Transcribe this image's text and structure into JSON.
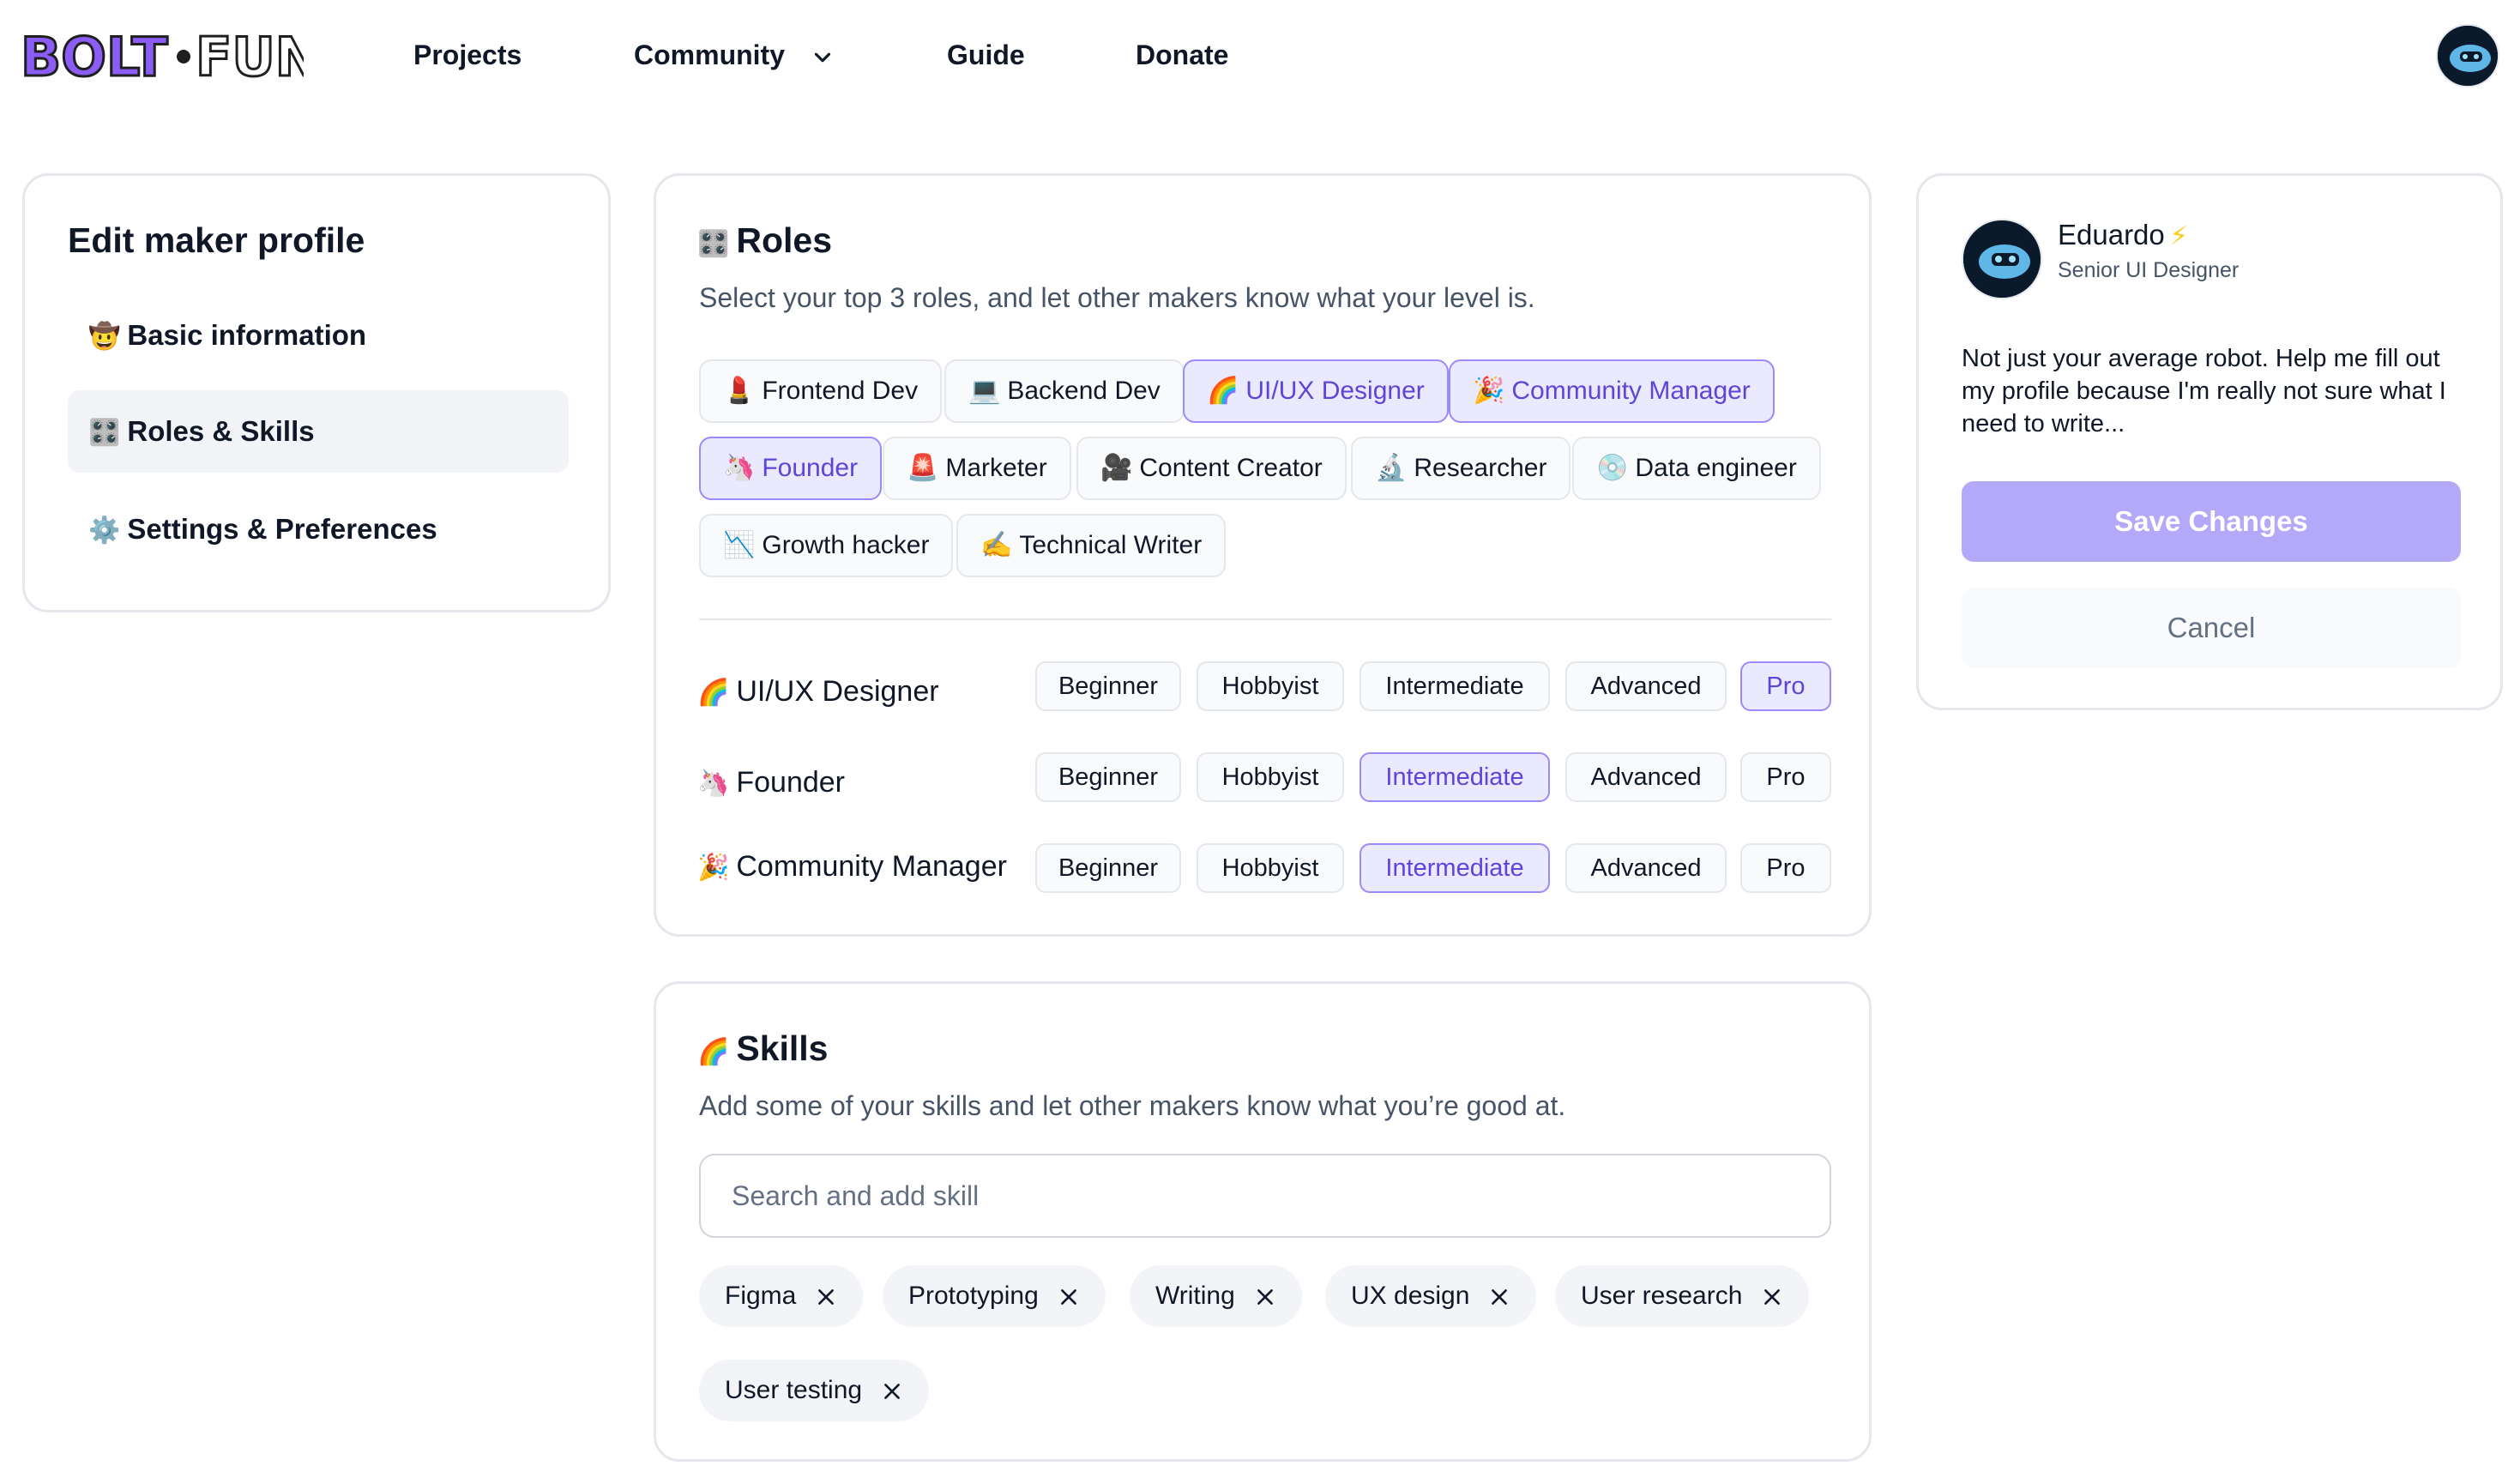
{
  "nav": {
    "logo_text": "BOLT.FUN",
    "links": [
      "Projects",
      "Community",
      "Guide",
      "Donate"
    ],
    "avatar_icon": "robot-avatar-icon"
  },
  "left": {
    "title": "Edit maker profile",
    "items": [
      {
        "emoji": "🤠",
        "label": "Basic information"
      },
      {
        "emoji": "🎛️",
        "label": "Roles & Skills"
      },
      {
        "emoji": "⚙️",
        "label": "Settings & Preferences"
      }
    ],
    "active_index": 1
  },
  "roles": {
    "title_emoji": "🎛️",
    "title": "Roles",
    "subtitle": "Select your top 3 roles, and let other makers know what your level is.",
    "chips": [
      {
        "emoji": "💄",
        "label": "Frontend Dev",
        "selected": false
      },
      {
        "emoji": "💻",
        "label": "Backend Dev",
        "selected": false
      },
      {
        "emoji": "🌈",
        "label": "UI/UX Designer",
        "selected": true
      },
      {
        "emoji": "🎉",
        "label": "Community Manager",
        "selected": true
      },
      {
        "emoji": "🦄",
        "label": "Founder",
        "selected": true
      },
      {
        "emoji": "🚨",
        "label": "Marketer",
        "selected": false
      },
      {
        "emoji": "🎥",
        "label": "Content Creator",
        "selected": false
      },
      {
        "emoji": "🔬",
        "label": "Researcher",
        "selected": false
      },
      {
        "emoji": "💿",
        "label": "Data engineer",
        "selected": false
      },
      {
        "emoji": "📉",
        "label": "Growth hacker",
        "selected": false
      },
      {
        "emoji": "✍️",
        "label": "Technical Writer",
        "selected": false
      }
    ],
    "levels": [
      "Beginner",
      "Hobbyist",
      "Intermediate",
      "Advanced",
      "Pro"
    ],
    "selected_roles": [
      {
        "emoji": "🌈",
        "name": "UI/UX Designer",
        "level": "Pro"
      },
      {
        "emoji": "🦄",
        "name": "Founder",
        "level": "Intermediate"
      },
      {
        "emoji": "🎉",
        "name": "Community Manager",
        "level": "Intermediate"
      }
    ]
  },
  "skills": {
    "title_emoji": "🌈",
    "title": "Skills",
    "subtitle": "Add some of your skills and let other makers know what you’re good at.",
    "search_placeholder": "Search and add skill",
    "tags": [
      "Figma",
      "Prototyping",
      "Writing",
      "UX design",
      "User research",
      "User testing"
    ]
  },
  "profile": {
    "name": "Eduardo",
    "role": "Senior UI Designer",
    "bio": "Not just your average robot. Help me fill out my profile because I'm really not sure what I need to write...",
    "save_label": "Save Changes",
    "cancel_label": "Cancel"
  },
  "colors": {
    "accent": "#5c45d8",
    "accent_bg": "#ebe9fe",
    "primary_button": "#b4a8f9",
    "border": "#e4e7ec"
  }
}
